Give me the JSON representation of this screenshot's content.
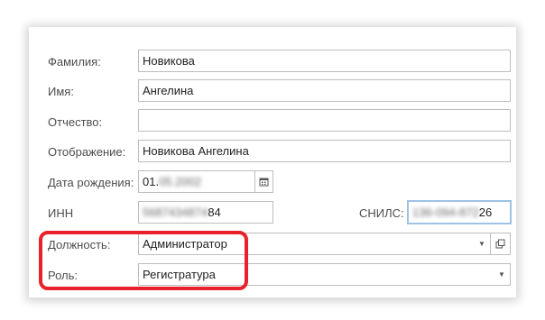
{
  "form": {
    "last_name": {
      "label": "Фамилия:",
      "value": "Новикова"
    },
    "first_name": {
      "label": "Имя:",
      "value": "Ангелина"
    },
    "patronymic": {
      "label": "Отчество:",
      "value": ""
    },
    "display": {
      "label": "Отображение:",
      "value": "Новикова Ангелина"
    },
    "birth_date": {
      "label": "Дата рождения:",
      "value_prefix": "01.",
      "value_hidden": "05.2002"
    },
    "inn": {
      "label": "ИНН",
      "value_hidden": "5687434874",
      "value_suffix": "84"
    },
    "snils": {
      "label": "СНИЛС:",
      "value_hidden": "136-094-872",
      "value_suffix": "26"
    },
    "position": {
      "label": "Должность:",
      "value": "Администратор"
    },
    "role": {
      "label": "Роль:",
      "value": "Регистратура"
    }
  },
  "icons": {
    "calendar": "calendar-icon",
    "dropdown": "chevron-down-icon",
    "open": "open-form-icon"
  },
  "colors": {
    "highlight": "#e8222b",
    "focus_border": "#9ec2e6"
  }
}
